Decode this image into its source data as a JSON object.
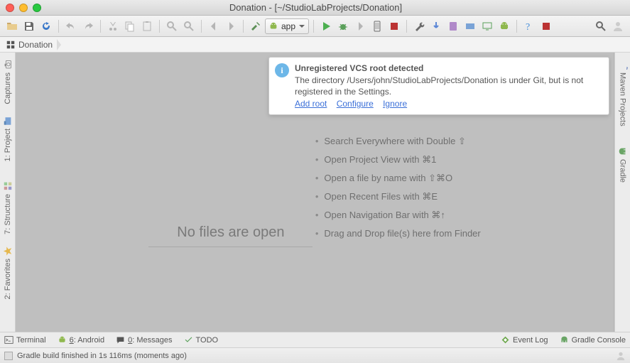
{
  "title": "Donation - [~/StudioLabProjects/Donation]",
  "breadcrumb": {
    "project": "Donation"
  },
  "run_config": {
    "label": "app"
  },
  "left_gutter": {
    "captures": "Captures",
    "project": "1: Project",
    "structure": "7: Structure",
    "favorites": "2: Favorites"
  },
  "right_gutter": {
    "maven": "Maven Projects",
    "gradle": "Gradle"
  },
  "notif": {
    "title": "Unregistered VCS root detected",
    "msg": "The directory /Users/john/StudioLabProjects/Donation is under Git, but is not registered in the Settings.",
    "links": {
      "add": "Add root",
      "configure": "Configure",
      "ignore": "Ignore"
    }
  },
  "empty": {
    "heading": "No files are open",
    "hints": [
      "Search Everywhere with Double ⇧",
      "Open Project View with ⌘1",
      "Open a file by name with ⇧⌘O",
      "Open Recent Files with ⌘E",
      "Open Navigation Bar with ⌘↑",
      "Drag and Drop file(s) here from Finder"
    ]
  },
  "bottom": {
    "terminal": "Terminal",
    "android": "6: Android",
    "messages": "0: Messages",
    "todo": "TODO",
    "eventlog": "Event Log",
    "gradle_console": "Gradle Console"
  },
  "status": {
    "msg": "Gradle build finished in 1s 116ms (moments ago)"
  }
}
